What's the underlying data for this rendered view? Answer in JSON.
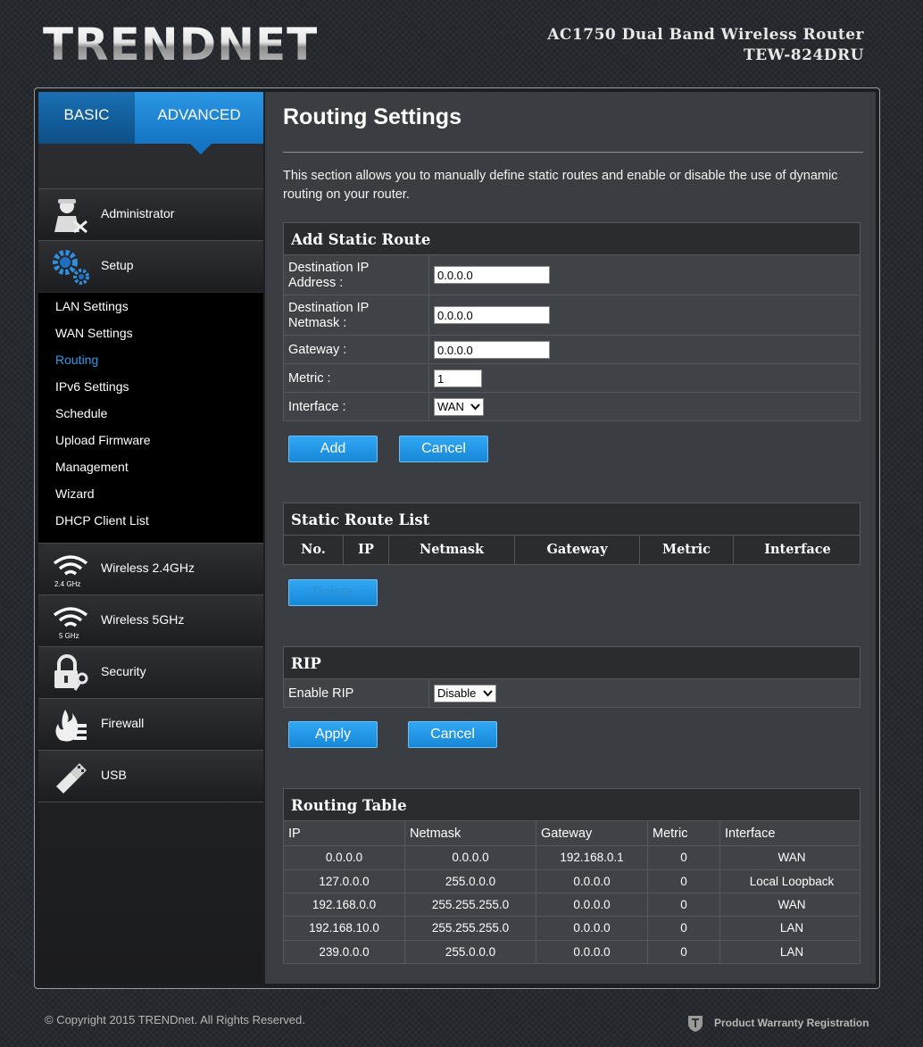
{
  "header": {
    "logo_text": "TRENDNET",
    "product_line1": "AC1750 Dual Band Wireless Router",
    "product_line2": "TEW-824DRU"
  },
  "tabs": {
    "basic": "BASIC",
    "advanced": "ADVANCED"
  },
  "menu": {
    "administrator": "Administrator",
    "setup": "Setup",
    "wireless24": "Wireless 2.4GHz",
    "wireless24_tag": "2.4 GHz",
    "wireless5": "Wireless 5GHz",
    "wireless5_tag": "5 GHz",
    "security": "Security",
    "firewall": "Firewall",
    "usb": "USB"
  },
  "submenu": [
    {
      "label": "LAN Settings",
      "active": false
    },
    {
      "label": "WAN Settings",
      "active": false
    },
    {
      "label": "Routing",
      "active": true
    },
    {
      "label": "IPv6 Settings",
      "active": false
    },
    {
      "label": "Schedule",
      "active": false
    },
    {
      "label": "Upload Firmware",
      "active": false
    },
    {
      "label": "Management",
      "active": false
    },
    {
      "label": "Wizard",
      "active": false
    },
    {
      "label": "DHCP Client List",
      "active": false
    }
  ],
  "page": {
    "title": "Routing Settings",
    "intro": "This section allows you to manually define static routes and enable or disable the use of dynamic routing on your router."
  },
  "static_route": {
    "heading": "Add Static Route",
    "dest_ip_label_1": "Destination IP",
    "dest_ip_label_2": "Address :",
    "dest_ip_value": "0.0.0.0",
    "dest_mask_label_1": "Destination IP",
    "dest_mask_label_2": "Netmask :",
    "dest_mask_value": "0.0.0.0",
    "gateway_label": "Gateway :",
    "gateway_value": "0.0.0.0",
    "metric_label": "Metric :",
    "metric_value": "1",
    "interface_label": "Interface :",
    "interface_value": "WAN",
    "add_button": "Add",
    "cancel_button": "Cancel"
  },
  "route_list": {
    "heading": "Static Route List",
    "columns": [
      "No.",
      "IP",
      "Netmask",
      "Gateway",
      "Metric",
      "Interface"
    ],
    "delete_button": "Delete"
  },
  "rip": {
    "heading": "RIP",
    "enable_label": "Enable RIP",
    "enable_value": "Disable",
    "apply_button": "Apply",
    "cancel_button": "Cancel"
  },
  "routing_table": {
    "heading": "Routing Table",
    "columns": [
      "IP",
      "Netmask",
      "Gateway",
      "Metric",
      "Interface"
    ],
    "rows": [
      [
        "0.0.0.0",
        "0.0.0.0",
        "192.168.0.1",
        "0",
        "WAN"
      ],
      [
        "127.0.0.0",
        "255.0.0.0",
        "0.0.0.0",
        "0",
        "Local Loopback"
      ],
      [
        "192.168.0.0",
        "255.255.255.0",
        "0.0.0.0",
        "0",
        "WAN"
      ],
      [
        "192.168.10.0",
        "255.255.255.0",
        "0.0.0.0",
        "0",
        "LAN"
      ],
      [
        "239.0.0.0",
        "255.0.0.0",
        "0.0.0.0",
        "0",
        "LAN"
      ]
    ]
  },
  "footer": {
    "copyright": "© Copyright 2015 TRENDnet. All Rights Reserved.",
    "warranty": "Product Warranty Registration"
  }
}
